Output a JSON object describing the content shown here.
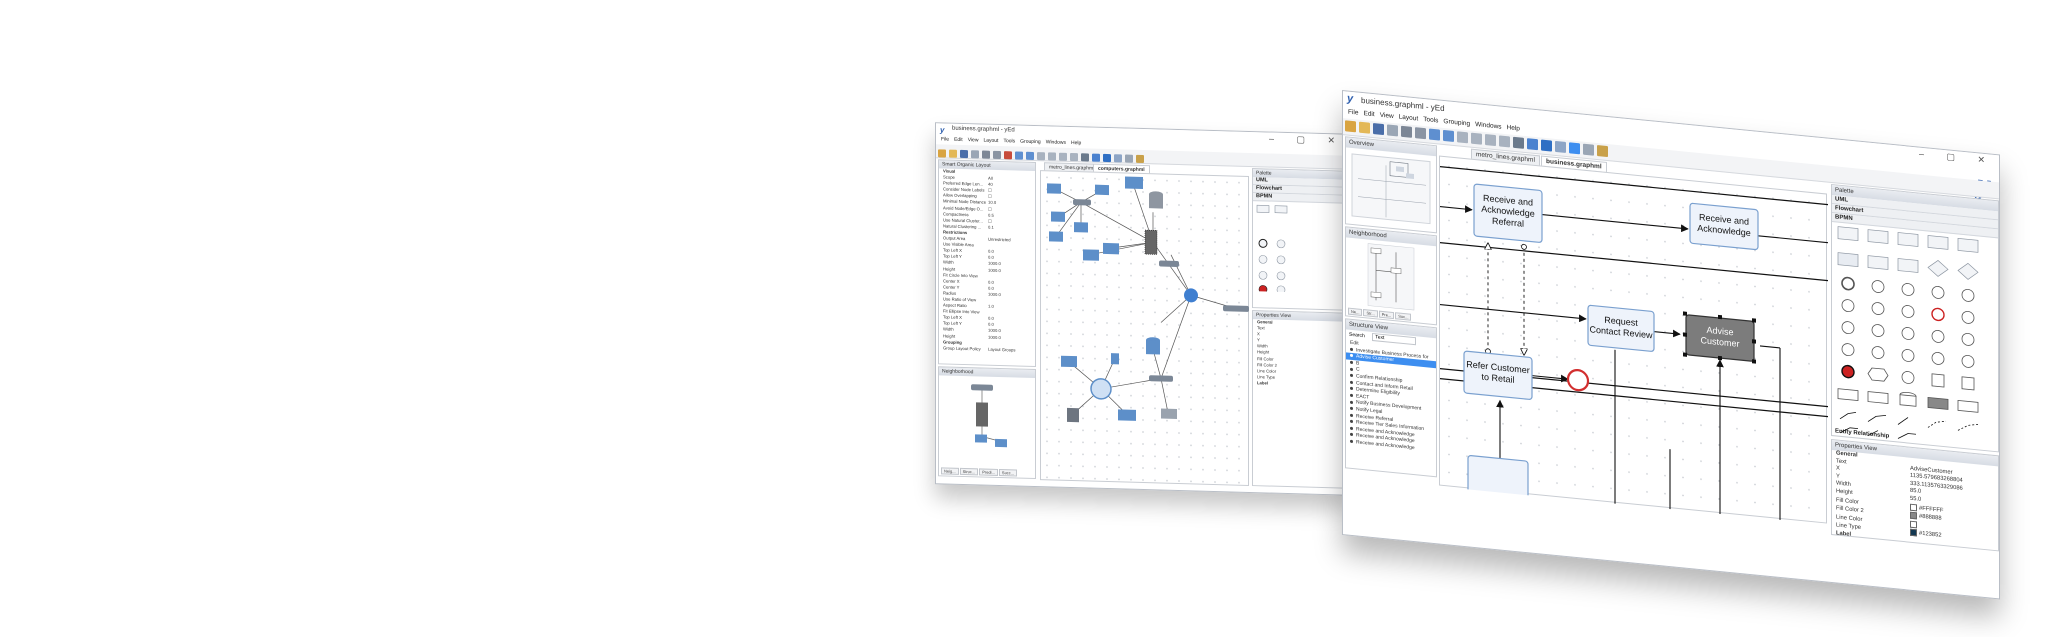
{
  "colors": {
    "accent": "#2f5fae",
    "selection": "#3d8ef0",
    "node_fill": "#eef3fb",
    "node_stroke": "#7aa0cf",
    "dark_node": "#7c7c7c",
    "end_event": "#d22f2f",
    "network_blue": "#5d8fc9"
  },
  "win1": {
    "title": "business.graphml - yEd",
    "menu": [
      "File",
      "Edit",
      "View",
      "Layout",
      "Tools",
      "Grouping",
      "Windows",
      "Help"
    ],
    "left_panel_title": "Smart Organic Layout",
    "properties": [
      {
        "k": "Visual",
        "v": "",
        "section": true
      },
      {
        "k": "Scope",
        "v": "All"
      },
      {
        "k": "Preferred Edge Len...",
        "v": "40"
      },
      {
        "k": "Consider Node Labels",
        "v": "☐"
      },
      {
        "k": "Allow Overlapping",
        "v": "☐"
      },
      {
        "k": "Minimal Node Distance",
        "v": "10.0"
      },
      {
        "k": "Avoid Node/Edge O...",
        "v": "☐"
      },
      {
        "k": "Compactness",
        "v": "0.5"
      },
      {
        "k": "Use Natural Cluster...",
        "v": "☐"
      },
      {
        "k": "Natural Clustering ...",
        "v": "0.1"
      },
      {
        "k": "Restrictions",
        "v": "",
        "section": true
      },
      {
        "k": "Output Area",
        "v": "Unrestricted"
      },
      {
        "k": "Use Visible Area",
        "v": ""
      },
      {
        "k": "Top Left X",
        "v": "0.0"
      },
      {
        "k": "Top Left Y",
        "v": "0.0"
      },
      {
        "k": "Width",
        "v": "1000.0"
      },
      {
        "k": "Height",
        "v": "1000.0"
      },
      {
        "k": "Fit Circle Into View",
        "v": ""
      },
      {
        "k": "Center X",
        "v": "0.0"
      },
      {
        "k": "Center Y",
        "v": "0.0"
      },
      {
        "k": "Radius",
        "v": "1000.0"
      },
      {
        "k": "Use Ratio of View",
        "v": ""
      },
      {
        "k": "Aspect Ratio",
        "v": "1.0"
      },
      {
        "k": "Fit Ellipse Into View",
        "v": ""
      },
      {
        "k": "Top Left X",
        "v": "0.0"
      },
      {
        "k": "Top Left Y",
        "v": "0.0"
      },
      {
        "k": "Width",
        "v": "1000.0"
      },
      {
        "k": "Height",
        "v": "1000.0"
      },
      {
        "k": "Grouping",
        "v": "",
        "section": true
      },
      {
        "k": "Group Layout Policy",
        "v": "Layout Groups"
      }
    ],
    "neighborhood_title": "Neighborhood",
    "bottom_tabs": [
      "Neig...",
      "Struc...",
      "Predi...",
      "Succ..."
    ],
    "tabs": [
      "metro_lines.graphml",
      "computers.graphml"
    ],
    "palette_title": "Palette",
    "palette_items": [
      "UML",
      "Flowchart",
      "BPMN"
    ],
    "properties_view_title": "Properties View",
    "pv_rows": [
      "General",
      "Text",
      "X",
      "Y",
      "Width",
      "Height",
      "Fill Color",
      "Fill Color 2",
      "Line Color",
      "Line Type",
      "Label"
    ]
  },
  "win2": {
    "title": "business.graphml - yEd",
    "menu": [
      "File",
      "Edit",
      "View",
      "Layout",
      "Tools",
      "Grouping",
      "Windows",
      "Help"
    ],
    "overview_title": "Overview",
    "neighborhood_title": "Neighborhood",
    "neighborhood_tabs": [
      "Ne...",
      "Str...",
      "Pre...",
      "Suc..."
    ],
    "structure_title": "Structure View",
    "search_label": "Search",
    "search_value": "Text",
    "list_root": "Edit",
    "list_items": [
      "Investigate Business Process for",
      "Advise Customer",
      "B",
      "C",
      "Confirm Relationship",
      "Contact and Inform Retail",
      "Determine Eligibility",
      "EACT",
      "Notify Business Development",
      "Notify Legal",
      "Receive Referral",
      "Receive Tier Sales Information",
      "Receive and Acknowledge",
      "Receive and Acknowledge",
      "Receive and Acknowledge"
    ],
    "selected_index": 1,
    "tabs": [
      "metro_lines.graphml",
      "business.graphml"
    ],
    "nodes": {
      "receive_ack_referral": [
        "Receive and",
        "Acknowledge",
        "Referral"
      ],
      "receive_ack": [
        "Receive and",
        "Acknowledge"
      ],
      "request_contact": [
        "Request",
        "Contact Review"
      ],
      "advise_customer": [
        "Advise",
        "Customer"
      ],
      "refer_customer": [
        "Refer Customer",
        "to Retail"
      ]
    },
    "palette_title": "Palette",
    "palette_sections": [
      "UML",
      "Flowchart",
      "BPMN"
    ],
    "entity_rel_label": "Entity Relationship",
    "properties_view_title": "Properties View",
    "props": [
      {
        "k": "General",
        "v": "",
        "section": true
      },
      {
        "k": "Text",
        "v": "AdviseCustomer"
      },
      {
        "k": "X",
        "v": "1135.579683268804"
      },
      {
        "k": "Y",
        "v": "333.1135763329086"
      },
      {
        "k": "Width",
        "v": "85.0"
      },
      {
        "k": "Height",
        "v": "55.0"
      },
      {
        "k": "Fill Color",
        "v": "#FFFFFF",
        "swatch": "#ffffff"
      },
      {
        "k": "Fill Color 2",
        "v": "#888888",
        "swatch": "#888888"
      },
      {
        "k": "Line Color",
        "v": "",
        "swatch": "#ffffff"
      },
      {
        "k": "Line Type",
        "v": "#123852",
        "swatch": "#123852"
      },
      {
        "k": "Label",
        "v": "",
        "section": true
      }
    ]
  }
}
